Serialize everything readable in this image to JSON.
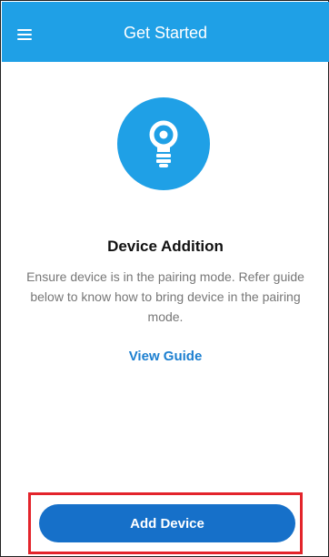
{
  "appbar": {
    "title": "Get Started",
    "menu_icon": "hamburger-menu-icon",
    "background_color": "#1fa0e6"
  },
  "hero": {
    "icon": "lightbulb-icon",
    "circle_color": "#1fa0e6"
  },
  "content": {
    "title": "Device Addition",
    "description": "Ensure device is in the pairing mode. Refer guide below to know how to bring device in the pairing mode.",
    "guide_link": "View Guide"
  },
  "footer": {
    "add_device_label": "Add Device",
    "button_color": "#1670c9",
    "highlight_color": "#e3242b"
  }
}
